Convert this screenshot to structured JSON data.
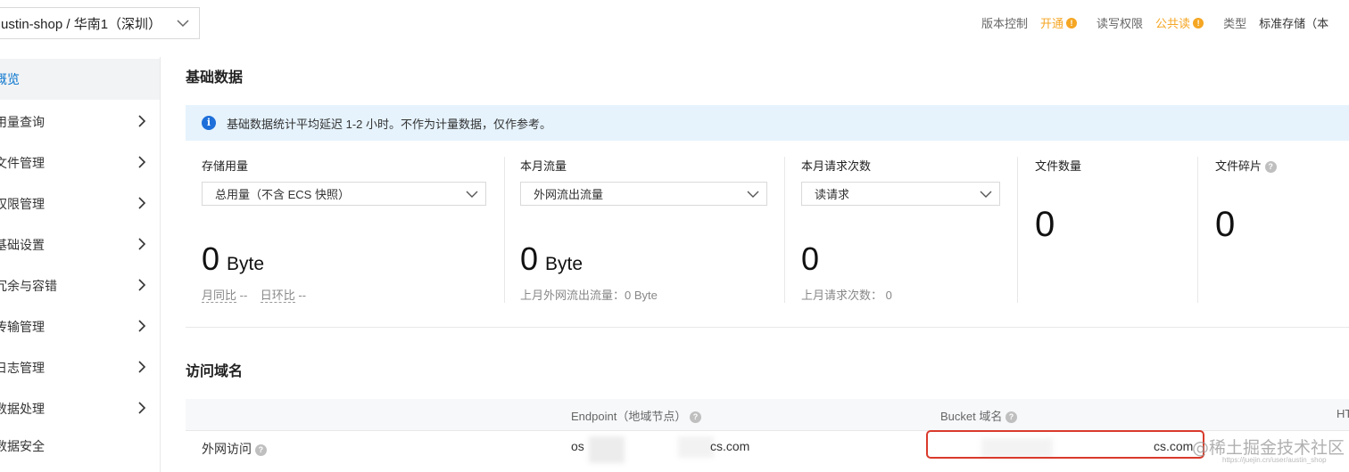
{
  "topbar": {
    "bucket_selector": "ustin-shop / 华南1（深圳）",
    "version_control_label": "版本控制",
    "version_control_value": "开通",
    "rw_label": "读写权限",
    "rw_value": "公共读",
    "type_label": "类型",
    "type_value": "标准存储（本",
    "warn_icon": "!"
  },
  "sidebar": {
    "items": [
      {
        "label": "概览",
        "has_arrow": false,
        "active": true
      },
      {
        "label": "用量查询",
        "has_arrow": true
      },
      {
        "label": "文件管理",
        "has_arrow": true
      },
      {
        "label": "权限管理",
        "has_arrow": true
      },
      {
        "label": "基础设置",
        "has_arrow": true
      },
      {
        "label": "冗余与容错",
        "has_arrow": true
      },
      {
        "label": "传输管理",
        "has_arrow": true
      },
      {
        "label": "日志管理",
        "has_arrow": true
      },
      {
        "label": "数据处理",
        "has_arrow": true
      },
      {
        "label": "数据安全",
        "has_arrow": false
      }
    ]
  },
  "basic": {
    "title": "基础数据",
    "notice": "基础数据统计平均延迟 1-2 小时。不作为计量数据，仅作参考。",
    "info_icon": "i",
    "storage": {
      "title": "存储用量",
      "dropdown": "总用量（不含 ECS 快照）",
      "value": "0",
      "unit": "Byte",
      "mom_label": "月同比",
      "mom_value": "--",
      "dod_label": "日环比",
      "dod_value": "--"
    },
    "traffic": {
      "title": "本月流量",
      "dropdown": "外网流出流量",
      "value": "0",
      "unit": "Byte",
      "last": "上月外网流出流量：0 Byte"
    },
    "requests": {
      "title": "本月请求次数",
      "dropdown": "读请求",
      "value": "0",
      "last": "上月请求次数：  0"
    },
    "files": {
      "title": "文件数量",
      "value": "0"
    },
    "fragments": {
      "title": "文件碎片",
      "value": "0",
      "help": "?"
    }
  },
  "domain": {
    "title": "访问域名",
    "columns": [
      "Endpoint（地域节点）",
      "Bucket 域名",
      "HT"
    ],
    "help": "?",
    "row_label": "外网访问",
    "endpoint_start": "os",
    "endpoint_end": "cs.com",
    "bucket_end": "cs.com"
  },
  "watermark": {
    "main": "@稀土掘金技术社区",
    "sub": "https://juejin.cn/user/austin_shop"
  },
  "colors": {
    "accent": "#0070cc",
    "warn": "#f5a623",
    "notice_bg": "#e6f3fd",
    "highlight": "#d93a2b"
  }
}
